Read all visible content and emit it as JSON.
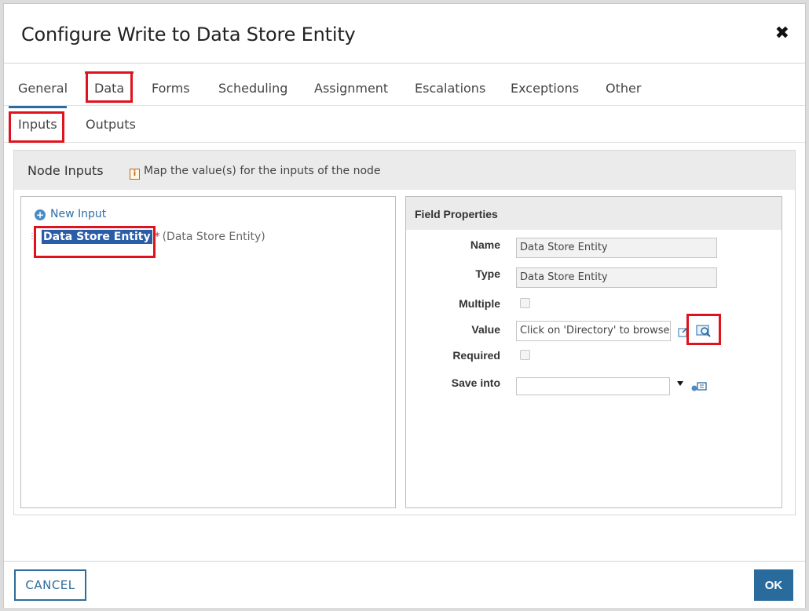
{
  "dialog": {
    "title": "Configure Write to Data Store Entity",
    "close_glyph": "✖"
  },
  "tabs": [
    {
      "label": "General"
    },
    {
      "label": "Data"
    },
    {
      "label": "Forms"
    },
    {
      "label": "Scheduling"
    },
    {
      "label": "Assignment"
    },
    {
      "label": "Escalations"
    },
    {
      "label": "Exceptions"
    },
    {
      "label": "Other"
    }
  ],
  "subtabs": [
    {
      "label": "Inputs"
    },
    {
      "label": "Outputs"
    }
  ],
  "panel": {
    "title": "Node Inputs",
    "info_icon": "i",
    "info": "Map the value(s) for the inputs of the node"
  },
  "tree": {
    "new_input": "New Input",
    "item": {
      "name": "Data Store Entity",
      "required_mark": "*",
      "type": "(Data Store Entity)"
    }
  },
  "field_properties": {
    "title": "Field Properties",
    "name_label": "Name",
    "name_value": "Data Store Entity",
    "type_label": "Type",
    "type_value": "Data Store Entity",
    "multiple_label": "Multiple",
    "value_label": "Value",
    "value_value": "Click on 'Directory' to browse...",
    "required_label": "Required",
    "save_into_label": "Save into",
    "save_into_value": ""
  },
  "footer": {
    "cancel": "CANCEL",
    "ok": "OK"
  },
  "colors": {
    "accent": "#2f6c9b",
    "highlight": "#e0121d",
    "selection": "#2a5da8"
  }
}
